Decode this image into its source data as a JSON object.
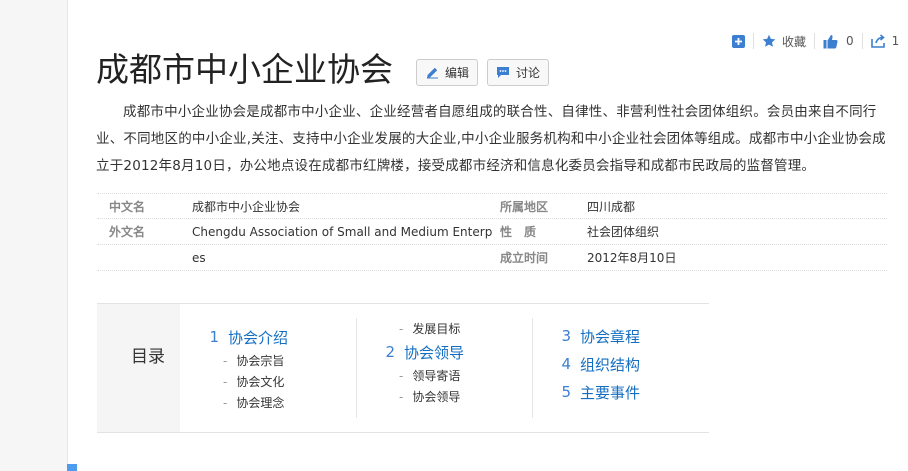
{
  "title": "成都市中小企业协会",
  "actions": {
    "collect_label": "收藏",
    "like_count": "0",
    "share_count": "1",
    "edit_label": "编辑",
    "discuss_label": "讨论"
  },
  "summary": "成都市中小企业协会是成都市中小企业、企业经营者自愿组成的联合性、自律性、非营利性社会团体组织。会员由来自不同行业、不同地区的中小企业,关注、支持中小企业发展的大企业,中小企业服务机构和中小企业社会团体等组成。成都市中小企业协会成立于2012年8月10日，办公地点设在成都市红牌楼，接受成都市经济和信息化委员会指导和成都市民政局的监督管理。",
  "basic_info": {
    "rows": [
      {
        "k1": "中文名",
        "v1": "成都市中小企业协会",
        "k2": "所属地区",
        "v2": "四川成都"
      },
      {
        "k1": "外文名",
        "v1": "Chengdu Association of Small and Medium Enterpris",
        "k2": "性　质",
        "v2": "社会团体组织"
      },
      {
        "k1": "",
        "v1": "es",
        "k2": "成立时间",
        "v2": "2012年8月10日"
      }
    ]
  },
  "catalog": {
    "title": "目录",
    "col1": {
      "h1": {
        "num": "1",
        "label": "协会介绍"
      },
      "subs": [
        "协会宗旨",
        "协会文化",
        "协会理念"
      ]
    },
    "col2": {
      "pre_sub": "发展目标",
      "h1": {
        "num": "2",
        "label": "协会领导"
      },
      "subs": [
        "领导寄语",
        "协会领导"
      ]
    },
    "col3": {
      "items": [
        {
          "num": "3",
          "label": "协会章程"
        },
        {
          "num": "4",
          "label": "组织结构"
        },
        {
          "num": "5",
          "label": "主要事件"
        }
      ]
    }
  },
  "colors": {
    "accent": "#3c7fd1",
    "link": "#136ec2"
  }
}
